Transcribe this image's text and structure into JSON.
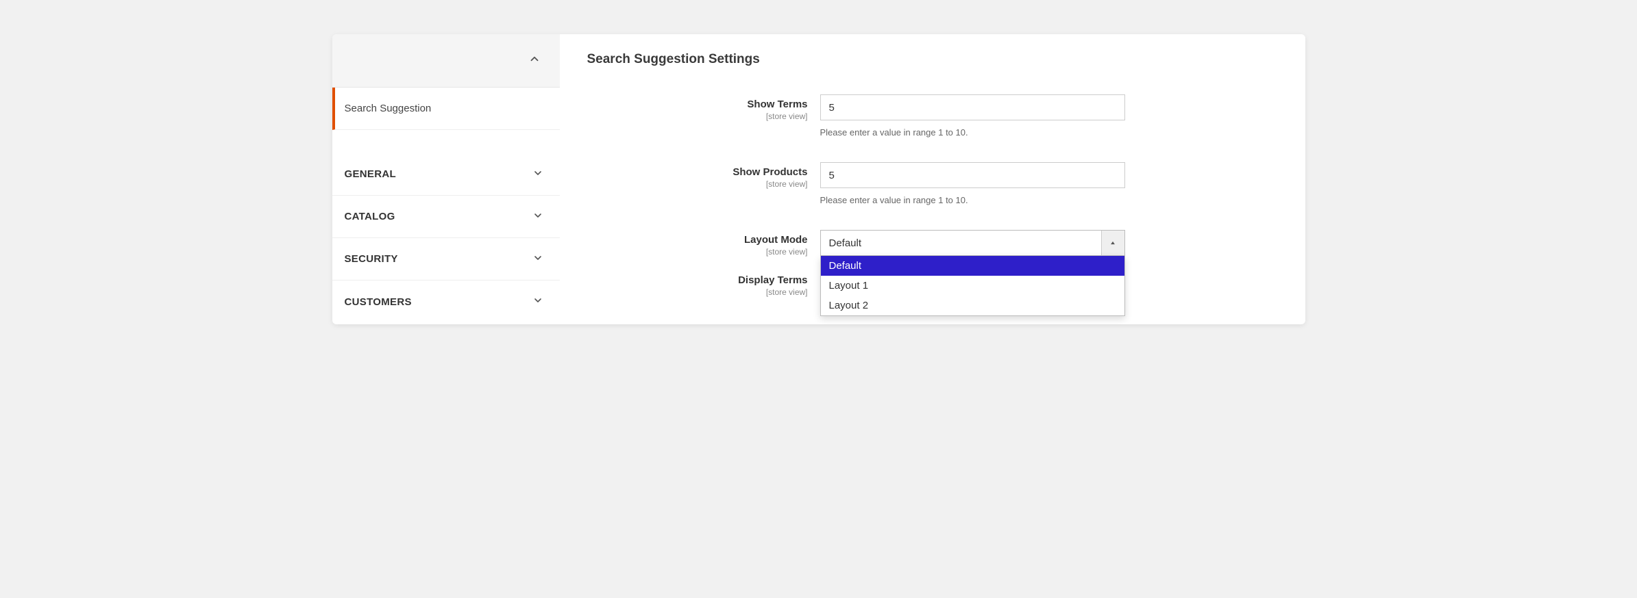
{
  "sidebar": {
    "active_item": "Search Suggestion",
    "sections": [
      "GENERAL",
      "CATALOG",
      "SECURITY",
      "CUSTOMERS"
    ]
  },
  "content": {
    "title": "Search Suggestion Settings",
    "scope_label": "[store view]",
    "fields": {
      "show_terms": {
        "label": "Show Terms",
        "value": "5",
        "hint": "Please enter a value in range 1 to 10."
      },
      "show_products": {
        "label": "Show Products",
        "value": "5",
        "hint": "Please enter a value in range 1 to 10."
      },
      "layout_mode": {
        "label": "Layout Mode",
        "value": "Default",
        "options": [
          "Default",
          "Layout 1",
          "Layout 2"
        ]
      },
      "display_terms": {
        "label": "Display Terms"
      }
    }
  }
}
